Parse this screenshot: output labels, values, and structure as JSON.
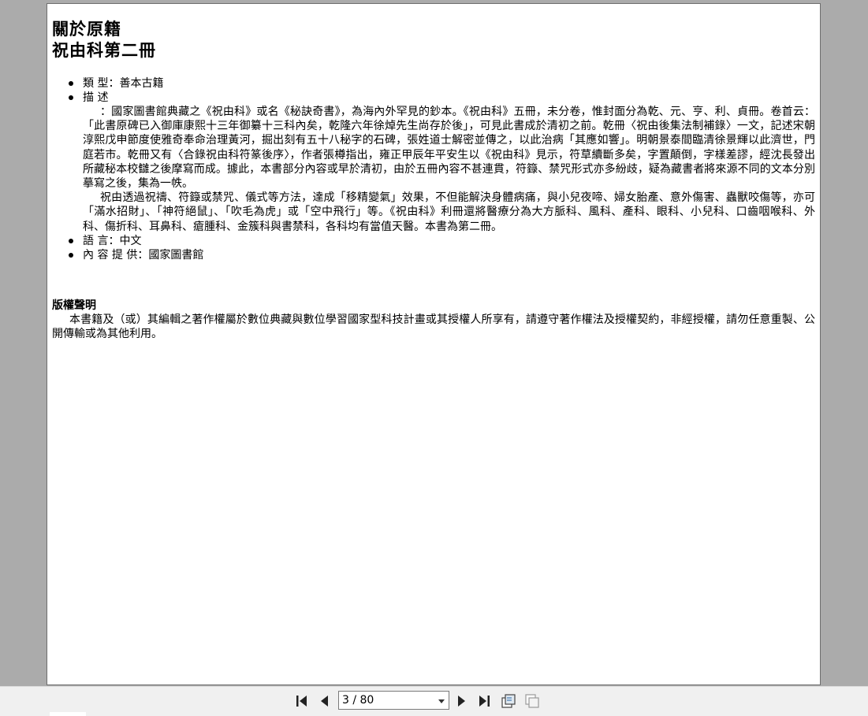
{
  "document": {
    "title_line1": "關於原籍",
    "title_line2": "祝由科第二冊",
    "fields": [
      {
        "label": "類 型：",
        "value": "善本古籍"
      },
      {
        "label": "描 述",
        "value": ""
      }
    ],
    "description_p1": "：國家圖書館典藏之《祝由科》或名《秘訣奇書》，為海內外罕見的鈔本。《祝由科》五冊，未分卷，惟封面分為乾、元、亨、利、貞冊。卷首云：「此書原碑已入御庫康熙十三年御纂十三科內矣，乾隆六年徐焯先生尚存於後」，可見此書成於清初之前。乾冊〈祝由後集法制補錄〉一文，記述宋朝淳熙戊申節度使雅奇奉命治理黃河，掘出刻有五十八秘字的石碑，張姓道士解密並傳之，以此治病「其應如響」。明朝景泰間臨清徐景輝以此濟世，門庭若市。乾冊又有〈合錄祝由科符篆後序〉，作者張樽指出，雍正甲辰年平安生以《祝由科》見示，符草續斷多矣，字置顛倒，字樣差謬，經沈長發出所藏秘本校讎之後摩寫而成。據此，本書部分內容或早於清初，由於五冊內容不甚連貫，符籙、禁咒形式亦多紛歧，疑為藏書者將來源不同的文本分別摹寫之後，集為一帙。",
    "description_p2": "祝由透過祝禱、符籙或禁咒、儀式等方法，達成「移精變氣」效果，不但能解決身體病痛，與小兒夜啼、婦女胎產、意外傷害、蟲獸咬傷等，亦可「滿水招財」、「神符絕鼠」、「吹毛為虎」或「空中飛行」等。《祝由科》利冊還將醫療分為大方脈科、風科、產科、眼科、小兒科、口齒咽喉科、外科、傷折科、耳鼻科、瘡腫科、金簇科與書禁科，各科均有當值天醫。本書為第二冊。",
    "language": {
      "label": "語 言：",
      "value": "中文"
    },
    "provider": {
      "label": "內 容 提 供：",
      "value": "國家圖書館"
    },
    "copyright_heading": "版權聲明",
    "copyright_text": "本書籍及（或）其編輯之著作權屬於數位典藏與數位學習國家型科技計畫或其授權人所享有，請遵守著作權法及授權契約，非經授權，請勿任意重製、公開傳輸或為其他利用。"
  },
  "toolbar": {
    "page_indicator": "3 / 80",
    "icons": [
      "first-page-icon",
      "previous-page-icon",
      "next-page-icon",
      "last-page-icon",
      "thumbnail-view-icon",
      "two-page-view-icon"
    ]
  }
}
